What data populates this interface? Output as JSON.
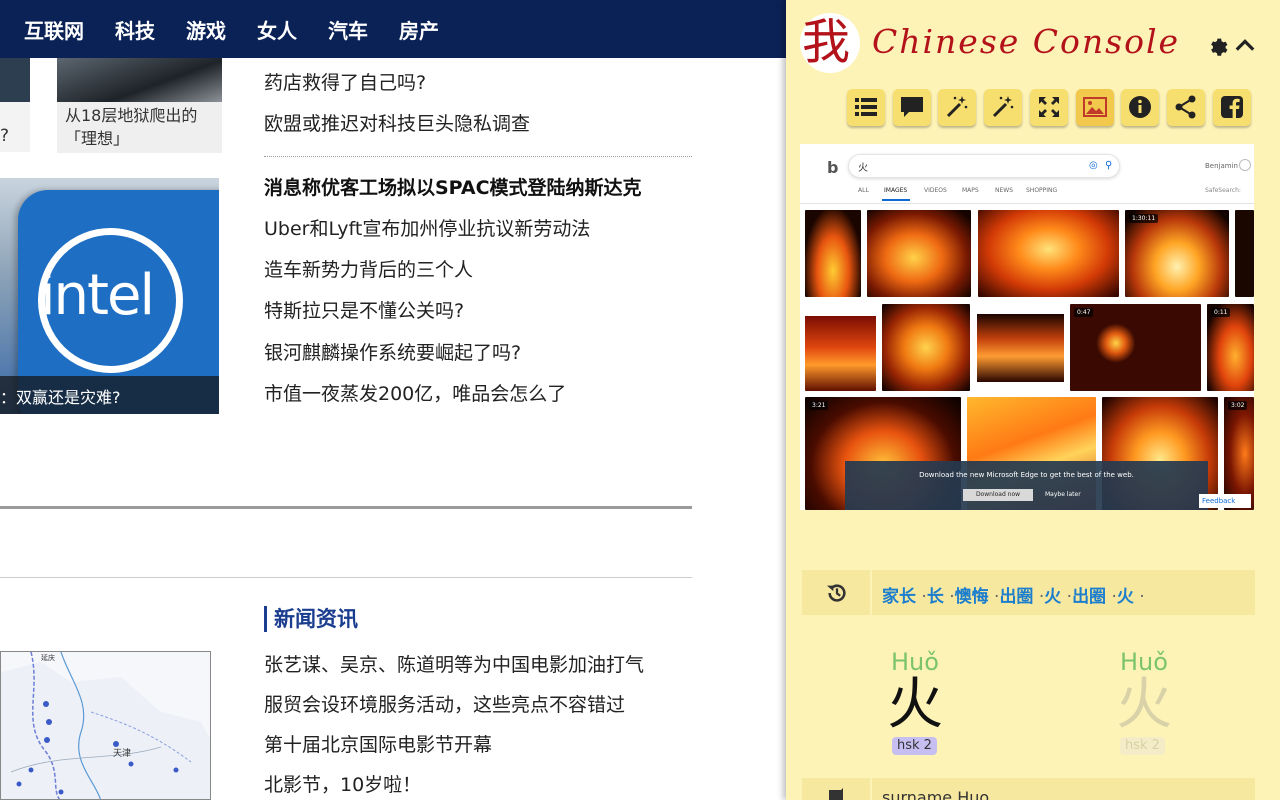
{
  "news_page": {
    "nav": [
      "互联网",
      "科技",
      "游戏",
      "女人",
      "汽车",
      "房产"
    ],
    "thumb_partial_caption": "?",
    "thumb_caption": "从18层地狱爬出的「理想」",
    "headlines_top": [
      "药店救得了自己吗?",
      "欧盟或推迟对科技巨头隐私调查"
    ],
    "headlines_mid": [
      "消息称优客工场拟以SPAC模式登陆纳斯达克",
      "Uber和Lyft宣布加州停业抗议新劳动法",
      "造车新势力背后的三个人",
      "特斯拉只是不懂公关吗?",
      "银河麒麟操作系统要崛起了吗?",
      "市值一夜蒸发200亿，唯品会怎么了"
    ],
    "intel_caption": "：双赢还是灾难?",
    "intel_logo": "intel",
    "section_title": "新闻资讯",
    "headlines_bottom": [
      "张艺谋、吴京、陈道明等为中国电影加油打气",
      "服贸会设环境服务活动，这些亮点不容错过",
      "第十届北京国际电影节开幕",
      "北影节，10岁啦！"
    ],
    "map_labels": [
      "延庆",
      "天津"
    ]
  },
  "extension": {
    "logo_char": "我",
    "title": "Chinese Console",
    "toolbar": [
      {
        "icon": "list-icon",
        "active": false
      },
      {
        "icon": "speech-bubble-icon",
        "active": false
      },
      {
        "icon": "magic-wand-icon",
        "active": false
      },
      {
        "icon": "magic-wand-icon",
        "active": false
      },
      {
        "icon": "expand-icon",
        "active": false
      },
      {
        "icon": "image-icon",
        "active": true
      },
      {
        "icon": "info-icon",
        "active": false
      },
      {
        "icon": "share-icon",
        "active": false
      },
      {
        "icon": "facebook-icon",
        "active": false
      }
    ],
    "image_search": {
      "query": "火",
      "user": "Benjamin",
      "tabs": [
        "ALL",
        "IMAGES",
        "VIDEOS",
        "MAPS",
        "NEWS",
        "SHOPPING"
      ],
      "safe_search": "SafeSearch:",
      "video_badges": [
        "1:30:11",
        "0:47",
        "0:11",
        "3:21",
        "3:02"
      ],
      "edge_message": "Download the new Microsoft Edge to get the best of the web.",
      "edge_download": "Download now",
      "edge_later": "Maybe later",
      "feedback": "Feedback"
    },
    "history": [
      "家长",
      "长",
      "懊悔",
      "出圈",
      "火",
      "出圈",
      "火"
    ],
    "entries": [
      {
        "pinyin": "Huǒ",
        "hanzi": "火",
        "hsk": "hsk 2"
      },
      {
        "pinyin": "Huǒ",
        "hanzi": "火",
        "hsk": "hsk 2"
      }
    ],
    "definition": "surname Huo",
    "colors": {
      "panel_bg": "#fdf3b7",
      "brand_red": "#b3121b",
      "button_yellow": "#f7df6f",
      "link_blue": "#1c7ecd",
      "pinyin_green": "#7cc46a",
      "nav_navy": "#0b2257"
    }
  }
}
